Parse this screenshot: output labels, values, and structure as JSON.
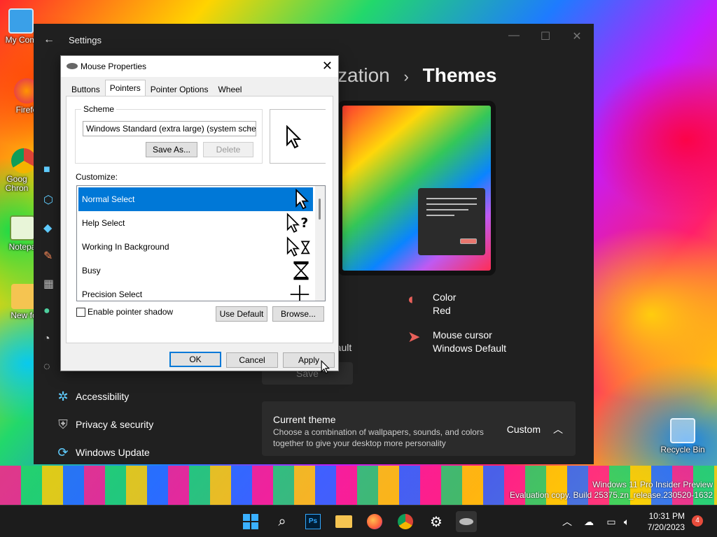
{
  "desktop": {
    "icons": [
      {
        "label": "My Com"
      },
      {
        "label": "Firefo"
      },
      {
        "label": "Goog Chron"
      },
      {
        "label": "Notepa"
      },
      {
        "label": "New fo"
      },
      {
        "label": "Recycle Bin"
      }
    ],
    "watermark": {
      "line1": "Windows 11 Pro Insider Preview",
      "line2": "Evaluation copy. Build 25375.zn_release.230520-1632"
    }
  },
  "settings": {
    "title": "Settings",
    "breadcrumb_parent": "zation",
    "breadcrumb_sep": "›",
    "breadcrumb_current": "Themes",
    "color_label": "Color",
    "color_value": "Red",
    "cursor_label": "Mouse cursor",
    "cursor_value": "Windows Default",
    "partial_default": "efault",
    "save_label": "Save",
    "nav": [
      {
        "label": "Accessibility"
      },
      {
        "label": "Privacy & security"
      },
      {
        "label": "Windows Update"
      }
    ],
    "current_theme": {
      "title": "Current theme",
      "desc": "Choose a combination of wallpapers, sounds, and colors together to give your desktop more personality",
      "value": "Custom"
    }
  },
  "mouse_dialog": {
    "title": "Mouse Properties",
    "tabs": [
      "Buttons",
      "Pointers",
      "Pointer Options",
      "Wheel"
    ],
    "active_tab": "Pointers",
    "scheme_label": "Scheme",
    "scheme_value": "Windows Standard (extra large) (system scheme",
    "save_as": "Save As...",
    "delete": "Delete",
    "customize_label": "Customize:",
    "pointers": [
      {
        "label": "Normal Select",
        "selected": true
      },
      {
        "label": "Help Select",
        "selected": false
      },
      {
        "label": "Working In Background",
        "selected": false
      },
      {
        "label": "Busy",
        "selected": false
      },
      {
        "label": "Precision Select",
        "selected": false
      }
    ],
    "shadow_label": "Enable pointer shadow",
    "use_default": "Use Default",
    "browse": "Browse...",
    "ok": "OK",
    "cancel": "Cancel",
    "apply": "Apply"
  },
  "taskbar": {
    "time": "10:31 PM",
    "date": "7/20/2023",
    "notification_count": "4"
  }
}
